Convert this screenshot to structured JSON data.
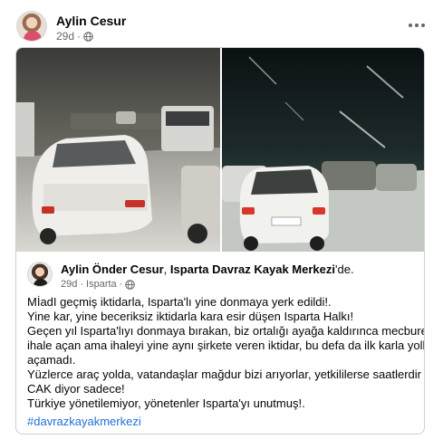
{
  "post": {
    "author": "Aylin Cesur",
    "time": "29d",
    "dot": "·",
    "privacy_icon": "globe-icon",
    "more_icon": "more-options-icon"
  },
  "shared": {
    "author": "Aylin Önder Cesur",
    "location": "Isparta Davraz Kayak Merkezi",
    "location_suffix": "'de.",
    "comma": ", ",
    "time": "29d",
    "place": "Isparta",
    "dot": "·",
    "lines": [
      "MİadI geçmiş iktidarla, Isparta'lı yine donmaya yerk edildi!.",
      "Yine kar, yine beceriksiz iktidarla kara esir düşen Isparta Halkı!",
      "Geçen yıl Isparta'lıyı donmaya bırakan, biz ortalığı ayağa kaldırınca mecburen",
      "ihale açan ama ihaleyi yine aynı şirkete veren iktidar, bu defa da ilk karla yolları",
      "açamadı.",
      "Yüzlerce araç yolda, vatandaşlar mağdur bizi arıyorlar, yetkililerse saatlerdir CEK",
      "CAK diyor sadece!",
      "Türkiye yönetilemiyor, yönetenler Isparta'yı unutmuş!."
    ],
    "hashtag": "#davrazkayakmerkezi"
  }
}
